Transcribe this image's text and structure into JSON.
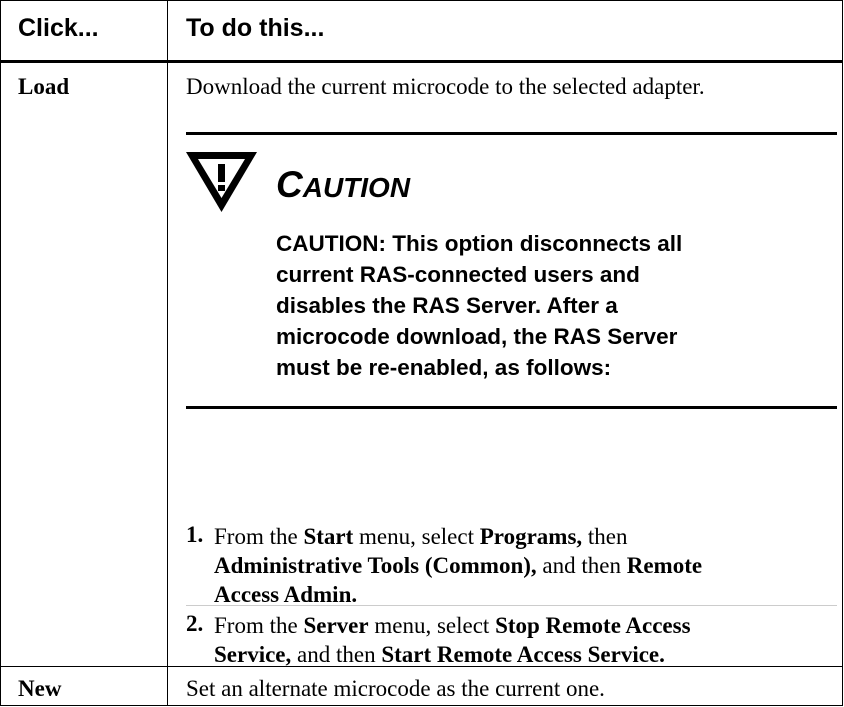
{
  "table": {
    "header": {
      "col1": "Click...",
      "col2": "To do this..."
    },
    "rows": [
      {
        "click": "Load",
        "desc": "Download the current microcode to the selected adapter.",
        "caution": {
          "title_first": "C",
          "title_rest": "AUTION",
          "text_lines": [
            "CAUTION: This option disconnects all",
            "current RAS-connected users and",
            "disables the RAS Server. After a",
            "microcode download, the RAS Server",
            "must be re-enabled, as follows:"
          ]
        },
        "steps": [
          {
            "num": "1.",
            "s1": "From the ",
            "b1": "Start",
            "s2": " menu, select ",
            "b2": "Programs,",
            "s3": " then",
            "b3": "Administrative Tools (Common),",
            "s4": " and then ",
            "b4": "Remote",
            "b5": "Access Admin."
          },
          {
            "num": "2.",
            "s1": "From the ",
            "b1": "Server",
            "s2": " menu, select ",
            "b2": "Stop Remote Access",
            "b3": "Service,",
            "s3": " and then ",
            "b4": "Start Remote Access Service."
          }
        ]
      },
      {
        "click": "New",
        "desc": "Set an alternate microcode as the current one."
      }
    ]
  }
}
